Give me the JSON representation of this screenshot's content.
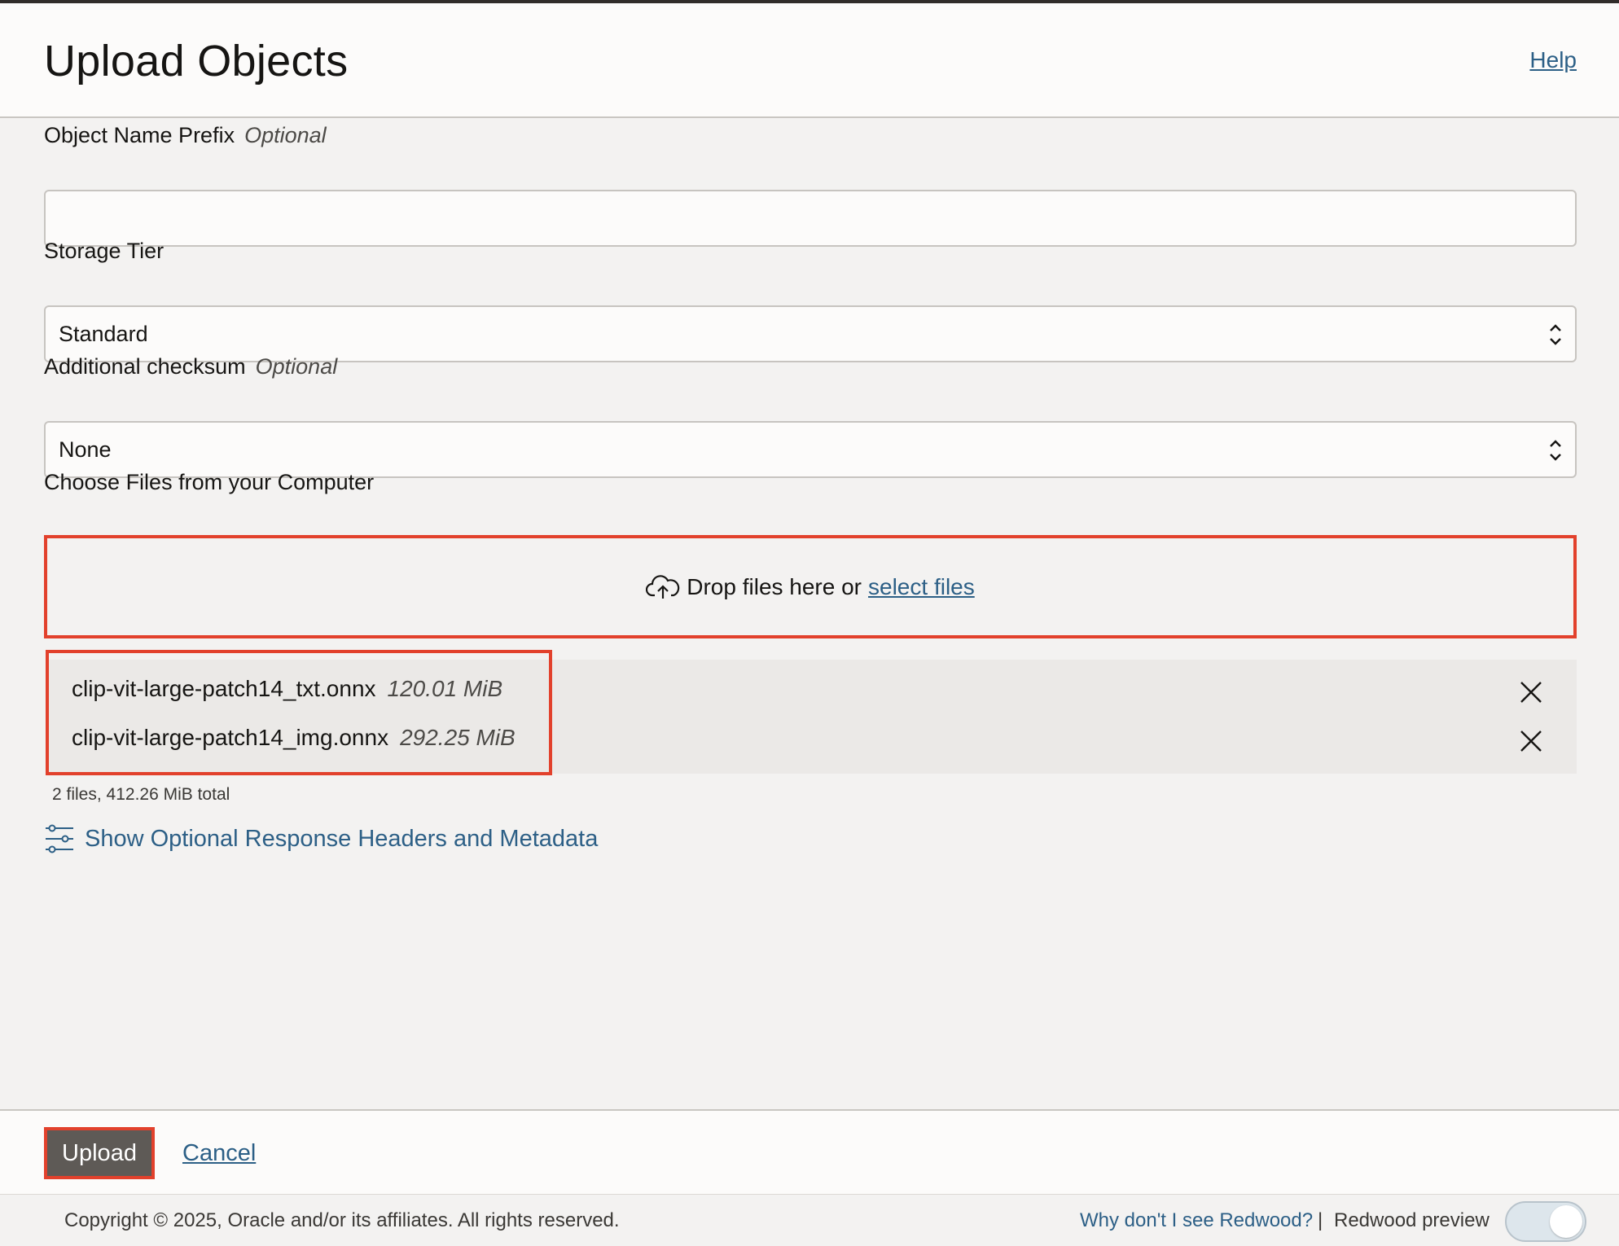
{
  "header": {
    "title": "Upload Objects",
    "help_label": "Help"
  },
  "form": {
    "prefix": {
      "label": "Object Name Prefix",
      "optional": "Optional",
      "value": ""
    },
    "storage_tier": {
      "label": "Storage Tier",
      "selected": "Standard"
    },
    "checksum": {
      "label": "Additional checksum",
      "optional": "Optional",
      "selected": "None"
    },
    "choose_files": {
      "label": "Choose Files from your Computer",
      "drop_text": "Drop files here or",
      "select_link": "select files"
    },
    "files": [
      {
        "name": "clip-vit-large-patch14_txt.onnx",
        "size": "120.01 MiB"
      },
      {
        "name": "clip-vit-large-patch14_img.onnx",
        "size": "292.25 MiB"
      }
    ],
    "summary": "2 files, 412.26 MiB total",
    "optional_headers_link": "Show Optional Response Headers and Metadata"
  },
  "actions": {
    "upload_label": "Upload",
    "cancel_label": "Cancel"
  },
  "footer": {
    "copyright": "Copyright © 2025, Oracle and/or its affiliates. All rights reserved.",
    "why_link": "Why don't I see Redwood?",
    "separator": "|",
    "preview_label": "Redwood preview",
    "preview_toggle_on": true
  },
  "colors": {
    "link": "#2c5f86",
    "highlight": "#e2412c",
    "primary_button": "#5e5a56"
  }
}
